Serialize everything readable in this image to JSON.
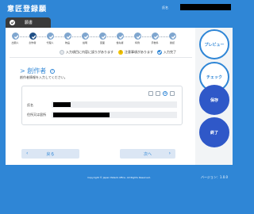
{
  "header": {
    "app_title": "意匠登録願",
    "user_label": "氏名",
    "tab_label": "願書"
  },
  "steps": [
    {
      "label": "出願人",
      "state": "done"
    },
    {
      "label": "創作者",
      "state": "current"
    },
    {
      "label": "代理人",
      "state": "done"
    },
    {
      "label": "物品",
      "state": "done"
    },
    {
      "label": "説明",
      "state": "done"
    },
    {
      "label": "図面",
      "state": "done"
    },
    {
      "label": "優先権",
      "state": "done"
    },
    {
      "label": "特例",
      "state": "done"
    },
    {
      "label": "手数料",
      "state": "done"
    },
    {
      "label": "確認",
      "state": "done"
    }
  ],
  "legend": [
    {
      "label": "入力項目に内容に誤りがあります",
      "icon": "circle-icon",
      "color": "#e3e6ea"
    },
    {
      "label": "注意事項があります",
      "icon": "alert-icon",
      "color": "#f2c200"
    },
    {
      "label": "入力完了",
      "icon": "check-icon",
      "color": "#2f86d6"
    }
  ],
  "section": {
    "title": "> 創作者",
    "help_mark": "?",
    "description": "創作者情報を入力してください。"
  },
  "form": {
    "fields": [
      {
        "label": "氏名"
      },
      {
        "label": "住所又は居所"
      }
    ]
  },
  "nav": {
    "prev_label": "戻る",
    "next_label": "次へ"
  },
  "side_buttons": {
    "preview": "プレビュー",
    "check": "チェック",
    "save": "保存",
    "finish": "終了"
  },
  "footer": {
    "copyright": "Copyright © Japan Patent office. All Rights Reserved.",
    "version": "バージョン：1.0.0"
  },
  "colors": {
    "primary": "#2f86d6",
    "accent_solid": "#2f58c8",
    "dark_tab": "#3a3a3a"
  }
}
